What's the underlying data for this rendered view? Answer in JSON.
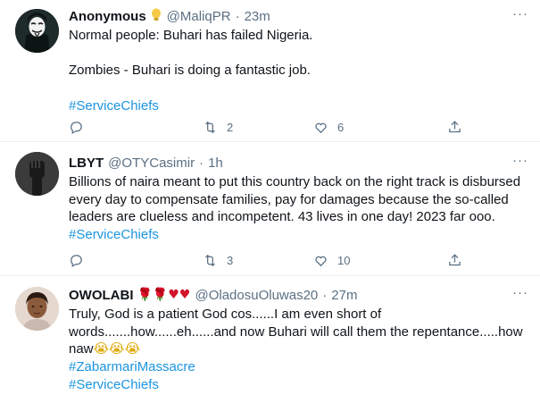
{
  "tweets": [
    {
      "name": "Anonymous",
      "badge_icon": "lightbulb-icon",
      "handle": "@MaliqPR",
      "time": "23m",
      "text_lines": [
        "Normal people: Buhari has failed Nigeria.",
        "",
        "Zombies - Buhari is doing a fantastic job."
      ],
      "hashtags": [
        "#ServiceChiefs"
      ],
      "reply_count": "",
      "retweet_count": "2",
      "like_count": "6"
    },
    {
      "name": "LBYT",
      "handle": "@OTYCasimir",
      "time": "1h",
      "text": "Billions of naira meant to put this country back on the right track is disbursed every day to compensate families, pay for damages because the so-called leaders are clueless and incompetent. 43 lives in one day! 2023 far ooo.",
      "hashtag": "#ServiceChiefs",
      "reply_count": "",
      "retweet_count": "3",
      "like_count": "10"
    },
    {
      "name": "OWOLABI",
      "name_emojis": "🌹🌹♥♥",
      "handle": "@OladosuOluwas20",
      "time": "27m",
      "text": "Truly, God is a patient God cos......I am even short of words.......how......eh......and now Buhari will call them the repentance.....how naw",
      "text_emojis": "😭😭😭",
      "hashtags": [
        "#ZabarmariMassacre",
        "#ServiceChiefs"
      ]
    }
  ],
  "separator": "·",
  "colors": {
    "link": "#1b95e0",
    "muted": "#5b7083",
    "divider": "#ebeef0"
  }
}
